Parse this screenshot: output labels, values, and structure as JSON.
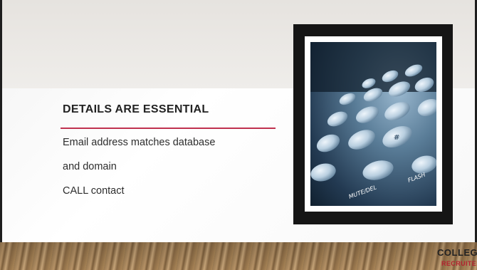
{
  "slide": {
    "title": "DETAILS ARE ESSENTIAL",
    "bullets": [
      "Email address matches database",
      "and domain",
      "CALL contact"
    ]
  },
  "photo": {
    "keypad_labels": [
      "#",
      "FLASH",
      "MUTE/DEL"
    ]
  },
  "logo": {
    "line1": "COLLEGE",
    "line2": "RECRUITER"
  },
  "colors": {
    "accent": "#c0314f",
    "frame": "#151515"
  }
}
